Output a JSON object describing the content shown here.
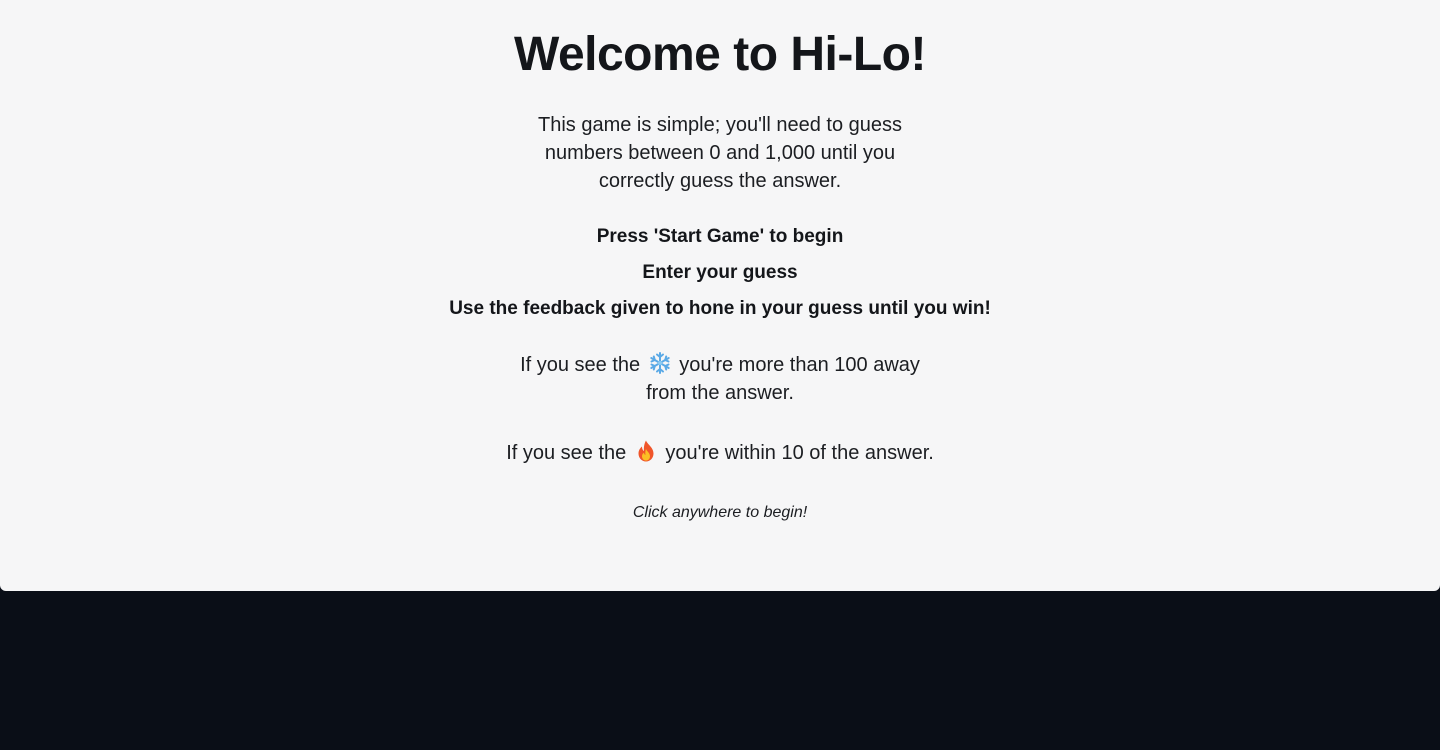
{
  "title": "Welcome to Hi-Lo!",
  "intro": "This game is simple; you'll need to guess numbers between 0 and 1,000 until you correctly guess the answer.",
  "steps": [
    "Press 'Start Game' to begin",
    "Enter your guess",
    "Use the feedback given to hone in your guess until you win!"
  ],
  "hints": {
    "cold": {
      "before": "If you see the",
      "icon": "snowflake-icon",
      "after": "you're more than 100 away from the answer."
    },
    "hot": {
      "before": "If you see the",
      "icon": "fire-icon",
      "after": "you're within 10 of the answer."
    }
  },
  "cta": "Click anywhere to begin!",
  "colors": {
    "overlay_bg": "#f6f6f7",
    "page_bg": "#0a0e17",
    "text": "#14161a"
  }
}
